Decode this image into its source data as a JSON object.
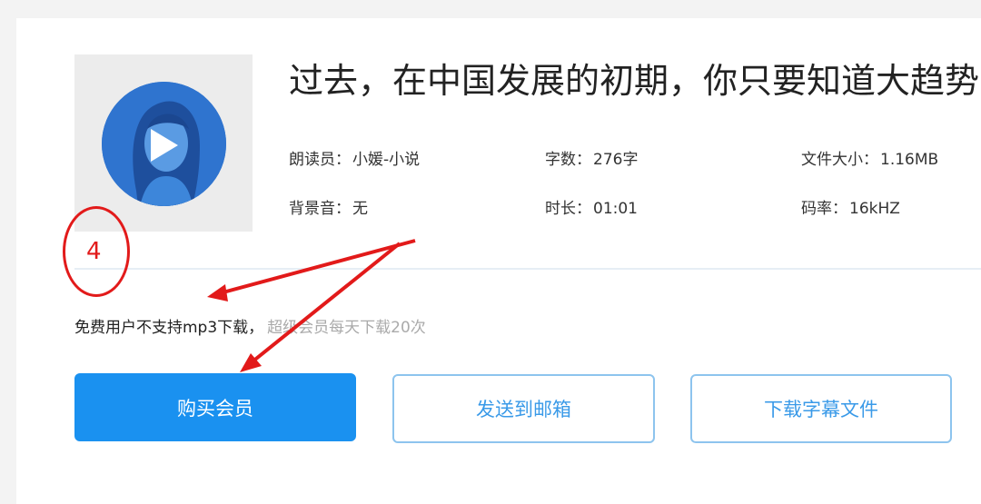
{
  "audio": {
    "title": "过去，在中国发展的初期，你只要知道大趋势",
    "reader_label": "朗读员：",
    "reader_value": "小媛-小说",
    "words_label": "字数：",
    "words_value": "276字",
    "filesize_label": "文件大小：",
    "filesize_value": "1.16MB",
    "bgm_label": "背景音：",
    "bgm_value": "无",
    "duration_label": "时长：",
    "duration_value": "01:01",
    "bitrate_label": "码率：",
    "bitrate_value": "16kHZ"
  },
  "notice": {
    "main": "免费用户不支持mp3下载，",
    "secondary": "超级会员每天下载20次"
  },
  "buttons": {
    "buy": "购买会员",
    "email": "发送到邮箱",
    "subtitles": "下载字幕文件"
  },
  "annotation": {
    "number": "4",
    "color": "#e21a1a"
  },
  "colors": {
    "primary": "#1a91f0",
    "outline": "#8dc4ee",
    "cover_bg": "#2f74cf"
  },
  "icons": {
    "cover": "woman-portrait-icon",
    "play": "play-icon"
  }
}
